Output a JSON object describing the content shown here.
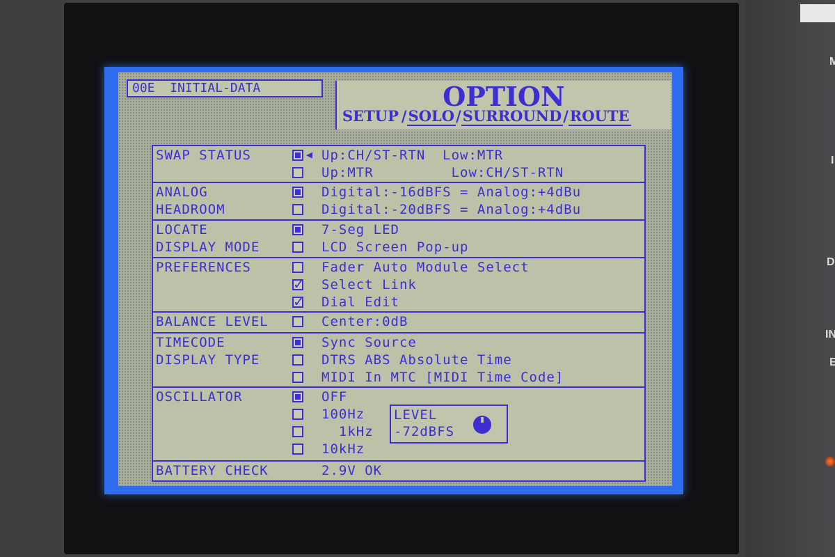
{
  "header": {
    "scene_label": "00E  INITIAL-DATA",
    "title": "OPTION",
    "tabs": [
      "SETUP",
      "SOLO",
      "SURROUND",
      "ROUTE"
    ],
    "tab_separator": "/"
  },
  "rows": [
    {
      "label": [
        "SWAP STATUS"
      ],
      "options": [
        {
          "state": "on",
          "text": "Up:CH/ST-RTN  Low:MTR",
          "arrow": true
        },
        {
          "state": "off",
          "text": "Up:MTR         Low:CH/ST-RTN"
        }
      ]
    },
    {
      "label": [
        "ANALOG",
        "HEADROOM"
      ],
      "options": [
        {
          "state": "on",
          "text": "Digital:-16dBFS = Analog:+4dBu"
        },
        {
          "state": "off",
          "text": "Digital:-20dBFS = Analog:+4dBu"
        }
      ]
    },
    {
      "label": [
        "LOCATE",
        "DISPLAY MODE"
      ],
      "options": [
        {
          "state": "on",
          "text": "7-Seg LED"
        },
        {
          "state": "off",
          "text": "LCD Screen Pop-up"
        }
      ]
    },
    {
      "label": [
        "PREFERENCES"
      ],
      "options": [
        {
          "state": "off",
          "text": "Fader Auto Module Select"
        },
        {
          "state": "check",
          "text": "Select Link"
        },
        {
          "state": "check",
          "text": "Dial Edit"
        }
      ]
    },
    {
      "label": [
        "BALANCE LEVEL"
      ],
      "options": [
        {
          "state": "off",
          "text": "Center:0dB"
        }
      ]
    },
    {
      "label": [
        "TIMECODE",
        "DISPLAY TYPE"
      ],
      "options": [
        {
          "state": "on",
          "text": "Sync Source"
        },
        {
          "state": "off",
          "text": "DTRS ABS Absolute Time"
        },
        {
          "state": "off",
          "text": "MIDI In MTC [MIDI Time Code]"
        }
      ]
    },
    {
      "label": [
        "OSCILLATOR"
      ],
      "options": [
        {
          "state": "on",
          "text": "OFF"
        },
        {
          "state": "off",
          "text": "100Hz"
        },
        {
          "state": "off",
          "text": "  1kHz"
        },
        {
          "state": "off",
          "text": "10kHz"
        }
      ]
    },
    {
      "label": [
        "BATTERY CHECK"
      ],
      "options": [
        {
          "state": "none",
          "text": "2.9V OK"
        }
      ]
    }
  ],
  "oscillator_level": {
    "label": "LEVEL",
    "value": "-72dBFS"
  },
  "bezel": {
    "labels": [
      "M",
      "I",
      "D",
      "IN",
      "E"
    ]
  },
  "colors": {
    "ink": "#3d2ed3",
    "lcd_bg": "#a9ae98",
    "backlight": "#2f6cf0"
  }
}
